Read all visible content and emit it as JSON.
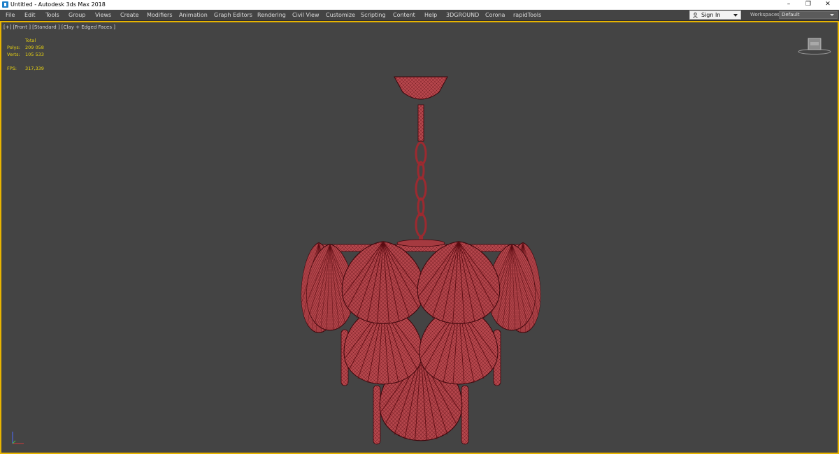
{
  "window": {
    "title": "Untitled - Autodesk 3ds Max 2018",
    "minimize_glyph": "–",
    "restore_glyph": "❐",
    "close_glyph": "✕"
  },
  "menu": {
    "items": [
      "File",
      "Edit",
      "Tools",
      "Group",
      "Views",
      "Create",
      "Modifiers",
      "Animation",
      "Graph Editors",
      "Rendering",
      "Civil View",
      "Customize",
      "Scripting",
      "Content",
      "Help",
      "3DGROUND",
      "Corona",
      "rapidTools"
    ]
  },
  "signin": {
    "label": "Sign In"
  },
  "workspaces": {
    "label": "Workspaces:",
    "value": "Default"
  },
  "viewport": {
    "label": "[+] [Front ] [Standard ] [Clay + Edged Faces ]",
    "stats": {
      "total_label": "Total",
      "polys_label": "Polys:",
      "polys_value": "209 058",
      "verts_label": "Verts:",
      "verts_value": "105 533",
      "fps_label": "FPS:",
      "fps_value": "317,339"
    }
  },
  "colors": {
    "viewport_bg": "#444444",
    "active_border": "#e8b400",
    "stats_text": "#e8d210",
    "mesh_fill": "#b5464c",
    "mesh_wire": "#5a0c12"
  },
  "icons": [
    "app-icon",
    "user-icon",
    "viewcube-icon",
    "axis-tripod-icon"
  ]
}
